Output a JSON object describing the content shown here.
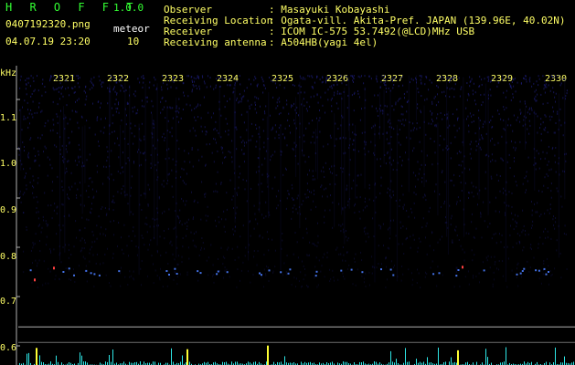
{
  "header": {
    "app_title": "H R O F F T",
    "version": "1.0.0",
    "filename": "0407192320.png",
    "datetime": "04.07.19 23:20",
    "meteor_label": "meteor",
    "meteor_count": "10"
  },
  "info": {
    "labels": [
      "Observer",
      "Receiving Location",
      "Receiver",
      "Receiving antenna"
    ],
    "values": [
      ": Masayuki Kobayashi",
      ": Ogata-vill. Akita-Pref. JAPAN (139.96E, 40.02N)",
      ": ICOM IC-575 53.7492(@LCD)MHz USB",
      ": A504HB(yagi 4el)"
    ]
  },
  "chart_data": {
    "type": "heatmap",
    "y_unit_label": "kHz",
    "x_ticks": [
      "2321",
      "2322",
      "2323",
      "2324",
      "2325",
      "2326",
      "2327",
      "2328",
      "2329",
      "2330"
    ],
    "y_ticks": [
      "1.1",
      "1.0",
      "0.9",
      "0.8",
      "0.7",
      "0.6"
    ],
    "xlim": [
      "23:20",
      "23:30"
    ],
    "ylim": [
      0.6,
      1.15
    ],
    "meteor_echo_frequency_khz": 0.755,
    "colors": {
      "background": "#000000",
      "noise": "#1a1a6e",
      "echo": "#4a7dff",
      "echo_strong": "#ff4040",
      "axis_text": "#ffff66",
      "title": "#33ff33",
      "frame": "#b0b0b0",
      "level_trace": "#33ffff",
      "level_peak": "#ffff33"
    }
  }
}
